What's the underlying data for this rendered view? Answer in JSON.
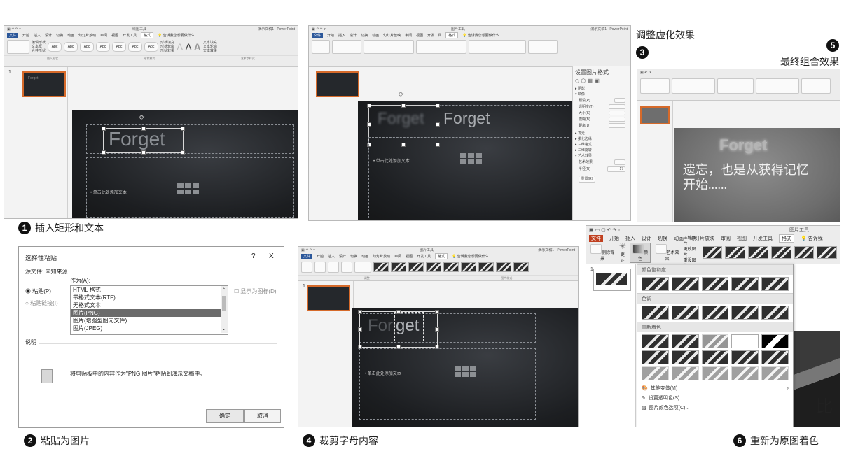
{
  "panels": {
    "p1": {
      "step": "1",
      "caption": "插入矩形和文本",
      "window_title": "演示文稿1 - PowerPoint",
      "context_tab": "绘图工具",
      "tabs": [
        "文件",
        "开始",
        "插入",
        "设计",
        "切换",
        "动画",
        "幻灯片放映",
        "审阅",
        "视图",
        "开发工具",
        "格式"
      ],
      "tell_me": "告诉我您想要做什么...",
      "ribbon_groups": [
        "插入形状",
        "形状样式",
        "艺术字样式"
      ],
      "style_buttons": [
        "Abc",
        "Abc",
        "Abc",
        "Abc",
        "Abc",
        "Abc",
        "Abc"
      ],
      "shape_options": [
        "形状填充",
        "形状轮廓",
        "形状效果"
      ],
      "edit_shape": "编辑形状",
      "text_box": "文本框",
      "merge_shapes": "合并形状",
      "wordart_labels": [
        "文本填充",
        "文本轮廓",
        "文本效果"
      ],
      "slide_number": "1",
      "thumb_text": "Forget",
      "slide_title": "Forget",
      "slide_bullet": "• 单击此处添加文本"
    },
    "p2": {
      "dialog_title": "选择性粘贴",
      "help": "?",
      "close": "X",
      "source_label": "源文件:",
      "source_value": "未知来源",
      "as_label": "作为(A):",
      "paste_option": "粘贴(P)",
      "paste_link_option": "粘贴链接(I)",
      "list_items": [
        "HTML 格式",
        "带格式文本(RTF)",
        "无格式文本",
        "图片(PNG)",
        "图片(增强型图元文件)",
        "图片(JPEG)"
      ],
      "selected_index": 3,
      "show_icon": "显示为图标(D)",
      "result_label": "说明",
      "result_text": "将剪贴板中的内容作为\"PNG 图片\"粘贴到演示文稿中。",
      "ok_button": "确定",
      "cancel_button": "取消",
      "step": "2",
      "caption": "粘贴为图片"
    },
    "p3": {
      "step_label": "调整虚化效果",
      "step": "3",
      "window_title": "演示文稿1 - PowerPoint",
      "context_tab": "图片工具",
      "tabs": [
        "文件",
        "开始",
        "插入",
        "设计",
        "切换",
        "动画",
        "幻灯片放映",
        "审阅",
        "视图",
        "开发工具",
        "格式"
      ],
      "tell_me": "告诉我您想要做什么...",
      "slide_text_left": "Forget",
      "slide_text_right": "Forget",
      "slide_bullet": "• 单击此处添加文本",
      "pane_title": "设置图片格式",
      "pane_sections": [
        "阴影",
        "映像",
        "发光",
        "柔化边缘",
        "三维格式",
        "三维旋转",
        "艺术效果"
      ],
      "pane_rows": [
        "预设(P)",
        "透明度(T)",
        "大小(S)",
        "模糊(B)",
        "距离(D)"
      ],
      "art_effect": "艺术效果",
      "radius_label": "半径(R)",
      "radius_value": "17",
      "reset_button": "重置(R)"
    },
    "p4": {
      "step": "4",
      "caption": "裁剪字母内容",
      "window_title": "演示文稿1 - PowerPoint",
      "context_tab": "图片工具",
      "tabs": [
        "文件",
        "开始",
        "插入",
        "设计",
        "切换",
        "动画",
        "幻灯片放映",
        "审阅",
        "视图",
        "开发工具",
        "格式"
      ],
      "tell_me": "告诉我您想要做什么...",
      "adjust_group": "调整",
      "styles_group": "图片样式",
      "slide_number": "1",
      "slide_text_dim": "For",
      "slide_text_crop": "get",
      "slide_bullet": "• 单击此处添加文本"
    },
    "p5": {
      "step": "5",
      "step_label": "最终组合效果",
      "slide_title": "Forget",
      "slide_text_line1": "遗忘，也是从获得记忆",
      "slide_text_line2": "开始......"
    },
    "p6": {
      "step": "6",
      "caption": "重新为原图着色",
      "context_tab": "图片工具",
      "tabs": [
        "文件",
        "开始",
        "插入",
        "设计",
        "切换",
        "动画",
        "幻灯片放映",
        "审阅",
        "视图",
        "开发工具",
        "格式"
      ],
      "tell_me": "告诉我",
      "tools": [
        "删除背景",
        "更正",
        "颜色",
        "艺术效果"
      ],
      "side_tools": [
        "压缩图片",
        "更改图片",
        "重设图片"
      ],
      "sections": [
        "颜色饱和度",
        "色调",
        "重新着色"
      ],
      "menu_items": [
        "其他变体(M)",
        "设置透明色(S)",
        "图片颜色选项(C)..."
      ],
      "slide_number": "1",
      "slide_partial_text": "比"
    }
  }
}
